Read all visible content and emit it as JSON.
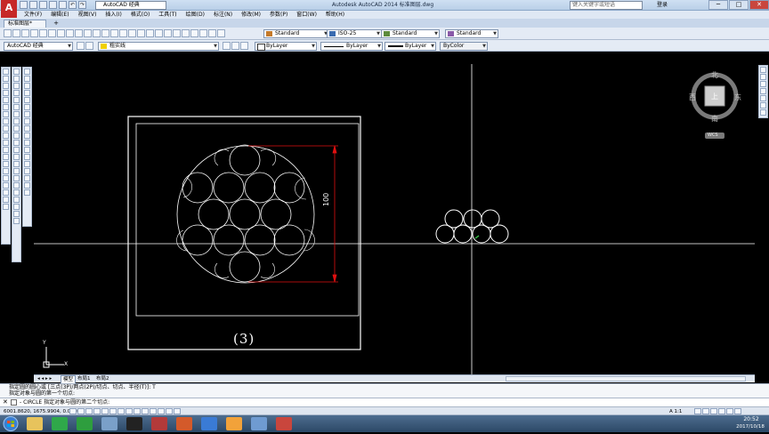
{
  "window": {
    "title": "Autodesk AutoCAD 2014    标准图层.dwg",
    "workspace": "AutoCAD 经典",
    "search_placeholder": "键入关键字或短语",
    "login": "登录",
    "buttons": [
      "─",
      "□",
      "✕"
    ]
  },
  "menu": [
    "文件(F)",
    "编辑(E)",
    "视图(V)",
    "插入(I)",
    "格式(O)",
    "工具(T)",
    "绘图(D)",
    "标注(N)",
    "修改(M)",
    "参数(P)",
    "窗口(W)",
    "帮助(H)"
  ],
  "file_tab": {
    "label": "标准图层*",
    "add": "+"
  },
  "toolbar_styles": {
    "text_style": "Standard",
    "dim_style": "ISO-25",
    "table_style": "Standard",
    "multileader_style": "Standard"
  },
  "layers_toolbar": {
    "workspace_combo": "AutoCAD 经典",
    "layer": "粗实线",
    "color": "ByLayer",
    "linetype": "ByLayer",
    "lineweight": "ByLayer",
    "plotstyle": "ByColor"
  },
  "viewcube": {
    "north": "北",
    "south": "南",
    "east": "东",
    "west": "西",
    "face": "上",
    "wcs": "WCS"
  },
  "drawing": {
    "label": "(3)",
    "dimension": "100",
    "ucs_y": "Y",
    "ucs_x": "X"
  },
  "layout_tabs": [
    "模型",
    "布局1",
    "布局2"
  ],
  "command": {
    "history_line1": "指定圆的圆心或 [三点(3P)/两点(2P)/切点、切点、半径(T)]: T",
    "history_line2": "指定对象与圆的第一个切点:",
    "prompt": "- CIRCLE 指定对象与圆的第二个切点:",
    "close": "✕"
  },
  "status": {
    "coords": "6001.8620, 1675.9904, 0.0000",
    "scale": "A 1:1"
  },
  "clock": {
    "time": "20:52",
    "date": "2017/10/18"
  },
  "colors": {
    "canvas": "#000000",
    "drawing_white": "#ffffff",
    "dimension_red": "#e01010",
    "accent_blue": "#2c4866"
  }
}
